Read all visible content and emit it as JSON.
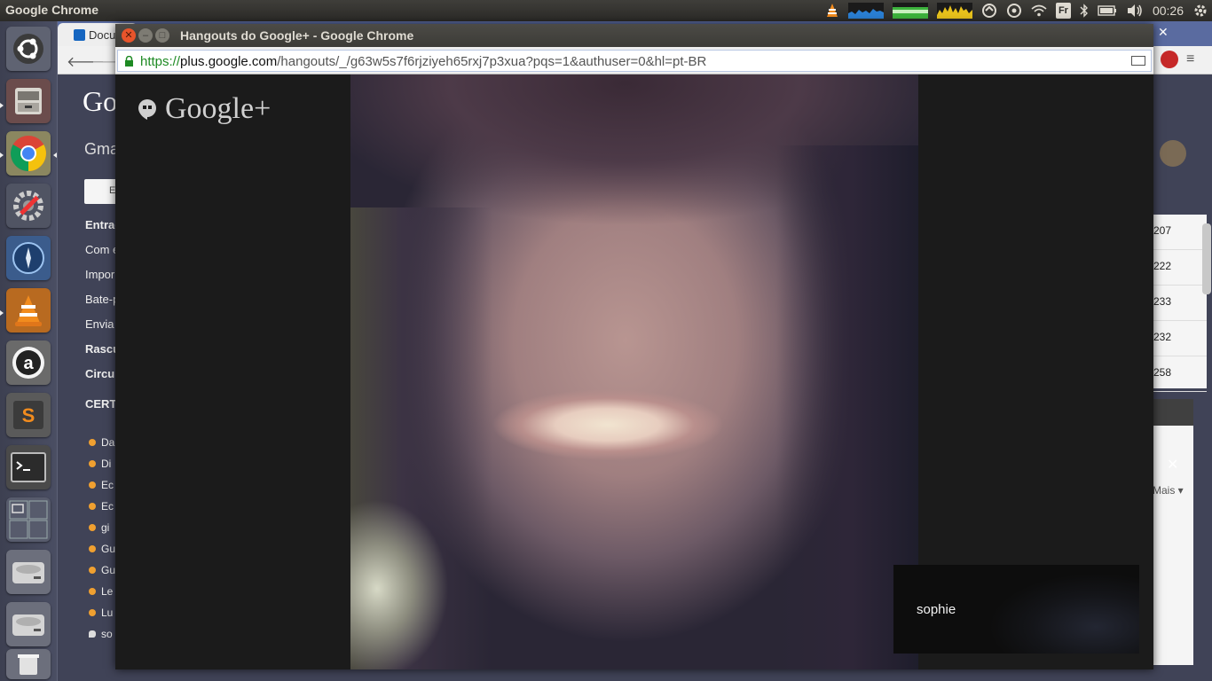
{
  "top_panel": {
    "app_title": "Google Chrome",
    "keyboard_layout": "Fr",
    "clock": "00:26",
    "icons": [
      "vlc-icon",
      "cpu-meter-icon",
      "memory-meter-icon",
      "network-meter-icon",
      "sync-icon",
      "update-icon",
      "wifi-icon",
      "keyboard-layout-icon",
      "bluetooth-icon",
      "battery-icon",
      "volume-icon",
      "clock",
      "power-gear-icon"
    ]
  },
  "launcher": {
    "items": [
      {
        "name": "dash-home",
        "icon": "ubuntu-logo-icon"
      },
      {
        "name": "files",
        "icon": "file-cabinet-icon"
      },
      {
        "name": "google-chrome",
        "icon": "chrome-icon"
      },
      {
        "name": "system-settings",
        "icon": "settings-wrench-icon"
      },
      {
        "name": "web-browser",
        "icon": "compass-icon"
      },
      {
        "name": "vlc",
        "icon": "vlc-cone-icon"
      },
      {
        "name": "amazon",
        "icon": "amazon-a-icon"
      },
      {
        "name": "sublime-text",
        "icon": "sublime-icon"
      },
      {
        "name": "terminal",
        "icon": "terminal-icon"
      },
      {
        "name": "workspaces",
        "icon": "workspace-switcher-icon"
      },
      {
        "name": "drive-1",
        "icon": "hard-drive-icon"
      },
      {
        "name": "drive-2",
        "icon": "hard-drive-icon"
      },
      {
        "name": "trash",
        "icon": "trash-icon"
      }
    ]
  },
  "bg_window": {
    "tab_label": "Docu",
    "gmail_logo": "Go",
    "gmail_label": "Gma",
    "compose_label": "E",
    "folders": [
      "Entrada",
      "Com e",
      "Impor",
      "Bate-p",
      "Envia",
      "Rascu",
      "Circu",
      "CERT"
    ],
    "contacts": [
      "Da",
      "Di",
      "Ec",
      "Ec",
      "gi",
      "Gu",
      "Gu",
      "Le",
      "Lu",
      "so"
    ],
    "peek_rows": [
      "207",
      "222",
      "233",
      "232",
      "258"
    ],
    "chat_more": "Mais ▾"
  },
  "hangout_window": {
    "title": "Hangouts do Google+ - Google Chrome",
    "url": {
      "scheme": "https://",
      "host": "plus.google.com",
      "path": "/hangouts/_/g63w5s7f6rjziyeh65rxj7p3xua?pqs=1&authuser=0&hl=pt-BR"
    },
    "logo_text": "Google+",
    "participant_name": "sophie"
  },
  "colors": {
    "hangout_bg": "#1b1b1b",
    "url_scheme_green": "#1e8a23",
    "ubuntu_close_orange": "#e8542b",
    "launcher_bg": "#3d4051"
  }
}
